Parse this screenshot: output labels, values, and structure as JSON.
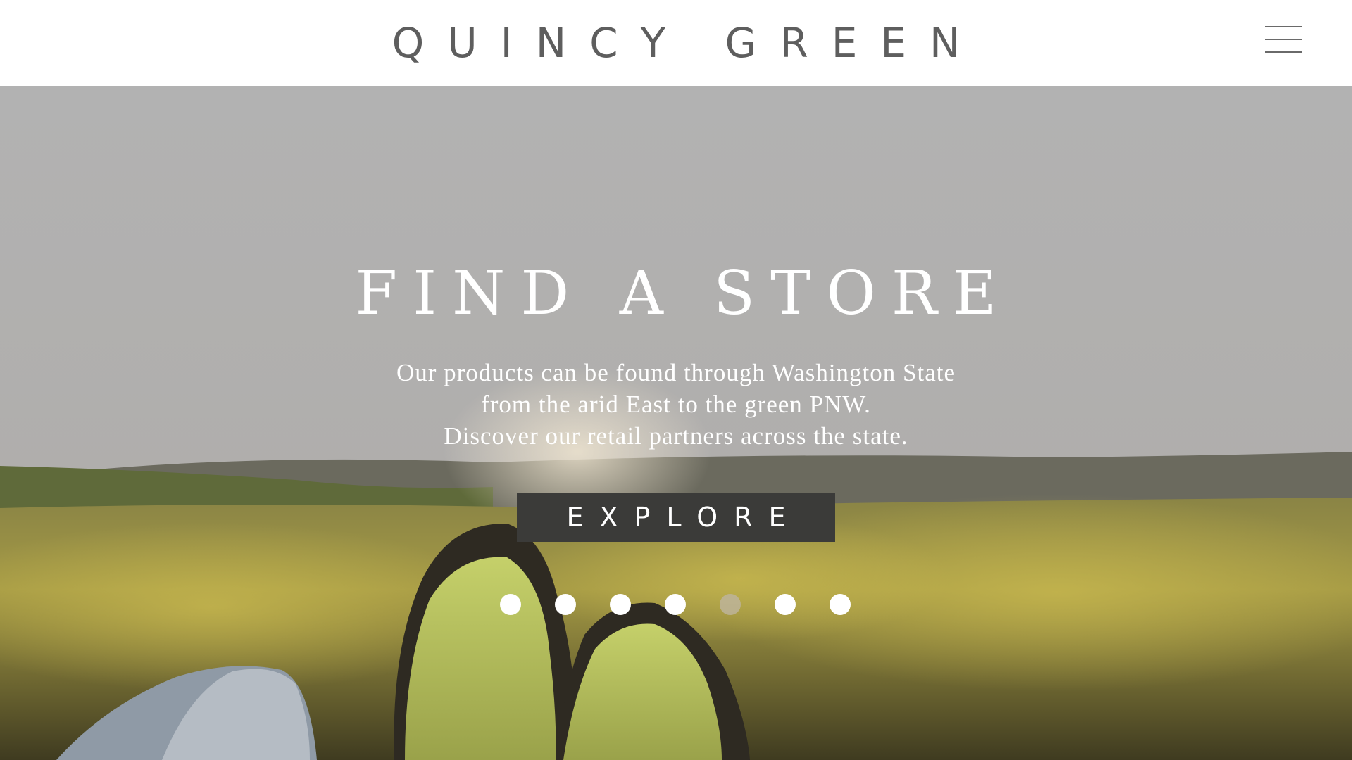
{
  "header": {
    "brand": "QUINCY GREEN",
    "menu_icon": "hamburger-menu-icon"
  },
  "hero": {
    "title": "FIND A STORE",
    "description_lines": [
      "Our products can be found through Washington State",
      "from the arid East to the green PNW.",
      "Discover our retail partners across the state."
    ],
    "cta_label": "EXPLORE",
    "slider": {
      "total_slides": 7,
      "active_index": 4
    }
  },
  "colors": {
    "header_bg": "#ffffff",
    "brand_text": "#5e5e5e",
    "button_bg": "#3b3b39",
    "hero_text": "#ffffff"
  }
}
